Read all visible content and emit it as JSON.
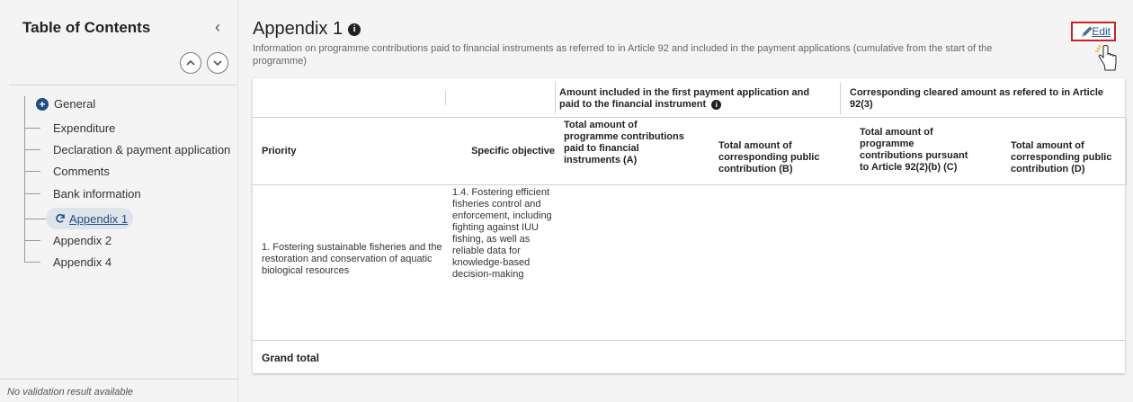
{
  "sidebar": {
    "title": "Table of Contents",
    "collapse_glyph": "‹",
    "general": "General",
    "items": [
      {
        "label": "Expenditure"
      },
      {
        "label": "Declaration & payment application"
      },
      {
        "label": "Comments"
      },
      {
        "label": "Bank information"
      },
      {
        "label": "Appendix 1",
        "active": true
      },
      {
        "label": "Appendix 2"
      },
      {
        "label": "Appendix 4"
      }
    ],
    "footer": "No validation result available"
  },
  "page": {
    "title": "Appendix 1",
    "info_glyph": "i",
    "subtitle": "Information on programme contributions paid to financial instruments as referred to in Article 92 and included in the payment applications (cumulative from the start of the programme)",
    "edit_label": "Edit"
  },
  "table": {
    "group_a": "Amount included in the first payment application and paid to the financial instrument",
    "group_b": "Corresponding cleared amount as refered to in Article 92(3)",
    "columns": {
      "priority": "Priority",
      "objective": "Specific objective",
      "col_a": "Total amount of programme contributions paid to financial instruments (A)",
      "col_b": "Total amount of corresponding public contribution  (B)",
      "col_c": "Total amount of programme contributions pursuant to Article 92(2)(b)  (C)",
      "col_d": "Total amount of corresponding public contribution  (D)"
    },
    "row": {
      "priority": "1. Fostering sustainable fisheries and the restoration and conservation of aquatic biological resources",
      "objective": "1.4. Fostering efficient fisheries control and enforcement, including fighting against IUU fishing, as well as reliable data for knowledge-based decision-making"
    },
    "grand_total": "Grand total"
  },
  "colors": {
    "accent": "#1d4e89",
    "highlight": "#cc2222"
  }
}
